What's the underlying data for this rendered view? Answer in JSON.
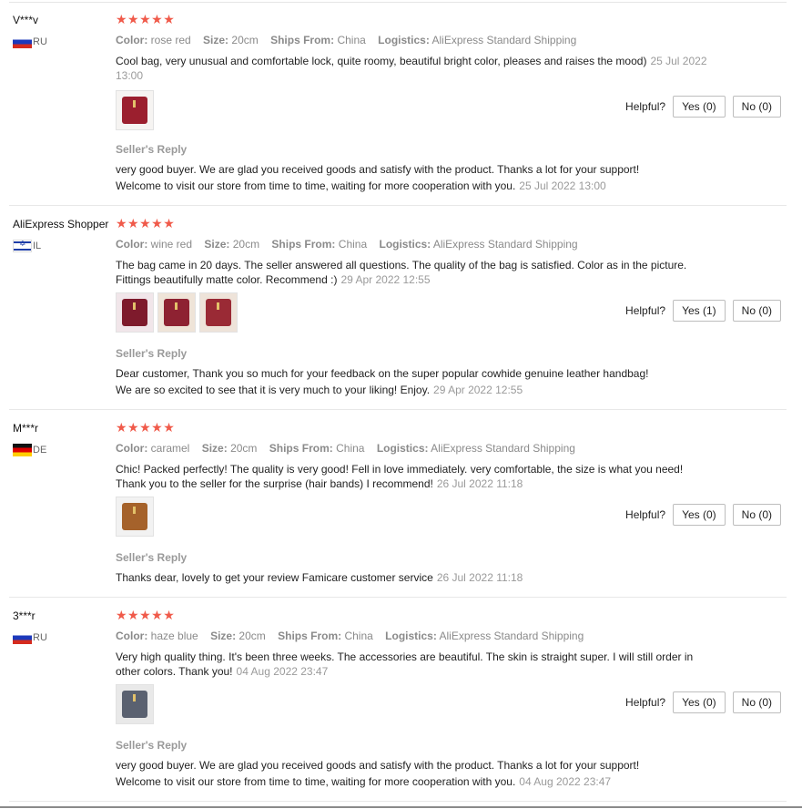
{
  "labels": {
    "color": "Color:",
    "size": "Size:",
    "ships_from": "Ships From:",
    "logistics": "Logistics:",
    "helpful": "Helpful?",
    "seller_reply": "Seller's Reply",
    "stars": "★★★★★"
  },
  "colors": {
    "star": "#f05a4a",
    "meta_gray": "#8a8a8a"
  },
  "reviews": [
    {
      "user": "V***v",
      "country": "RU",
      "flag": "russia-flag",
      "rating": 5,
      "color": "rose red",
      "size": "20cm",
      "ships_from": "China",
      "logistics": "AliExpress Standard Shipping",
      "text": "Cool bag, very unusual and comfortable lock, quite roomy, beautiful bright color, pleases and raises the mood)",
      "date": "25 Jul 2022 13:00",
      "photos": [
        "red-bag-photo"
      ],
      "yes": "Yes (0)",
      "no": "No (0)",
      "reply_line1": "very good buyer. We are glad you received goods and satisfy with the product. Thanks a lot for your support!",
      "reply_line2": "Welcome to visit our store from time to time, waiting for more cooperation with you.",
      "reply_date": "25 Jul 2022 13:00"
    },
    {
      "user": "AliExpress Shopper",
      "country": "IL",
      "flag": "israel-flag",
      "rating": 5,
      "color": "wine red",
      "size": "20cm",
      "ships_from": "China",
      "logistics": "AliExpress Standard Shipping",
      "text": "The bag came in 20 days. The seller answered all questions. The quality of the bag is satisfied. Color as in the picture. Fittings beautifully matte color. Recommend :)",
      "date": "29 Apr 2022 12:55",
      "photos": [
        "wine-bag-photo-1",
        "wine-bag-photo-2",
        "wine-bag-photo-3"
      ],
      "yes": "Yes (1)",
      "no": "No (0)",
      "reply_line1": "Dear customer, Thank you so much for your feedback on the super popular cowhide genuine leather handbag!",
      "reply_line2": "We are so excited to see that it is very much to your liking! Enjoy.",
      "reply_date": "29 Apr 2022 12:55"
    },
    {
      "user": "M***r",
      "country": "DE",
      "flag": "germany-flag",
      "rating": 5,
      "color": "caramel",
      "size": "20cm",
      "ships_from": "China",
      "logistics": "AliExpress Standard Shipping",
      "text": "Chic! Packed perfectly! The quality is very good! Fell in love immediately. very comfortable, the size is what you need! Thank you to the seller for the surprise (hair bands) I recommend!",
      "date": "26 Jul 2022 11:18",
      "photos": [
        "caramel-bag-photo"
      ],
      "yes": "Yes (0)",
      "no": "No (0)",
      "reply_line1": "Thanks dear, lovely to get your review Famicare customer service",
      "reply_line2": "",
      "reply_date": "26 Jul 2022 11:18"
    },
    {
      "user": "3***r",
      "country": "RU",
      "flag": "russia-flag",
      "rating": 5,
      "color": "haze blue",
      "size": "20cm",
      "ships_from": "China",
      "logistics": "AliExpress Standard Shipping",
      "text": "Very high quality thing. It's been three weeks. The accessories are beautiful. The skin is straight super. I will still order in other colors. Thank you!",
      "date": "04 Aug 2022 23:47",
      "photos": [
        "blue-bag-photo"
      ],
      "yes": "Yes (0)",
      "no": "No (0)",
      "reply_line1": "very good buyer. We are glad you received goods and satisfy with the product. Thanks a lot for your support!",
      "reply_line2": "Welcome to visit our store from time to time, waiting for more cooperation with you.",
      "reply_date": "04 Aug 2022 23:47"
    }
  ]
}
